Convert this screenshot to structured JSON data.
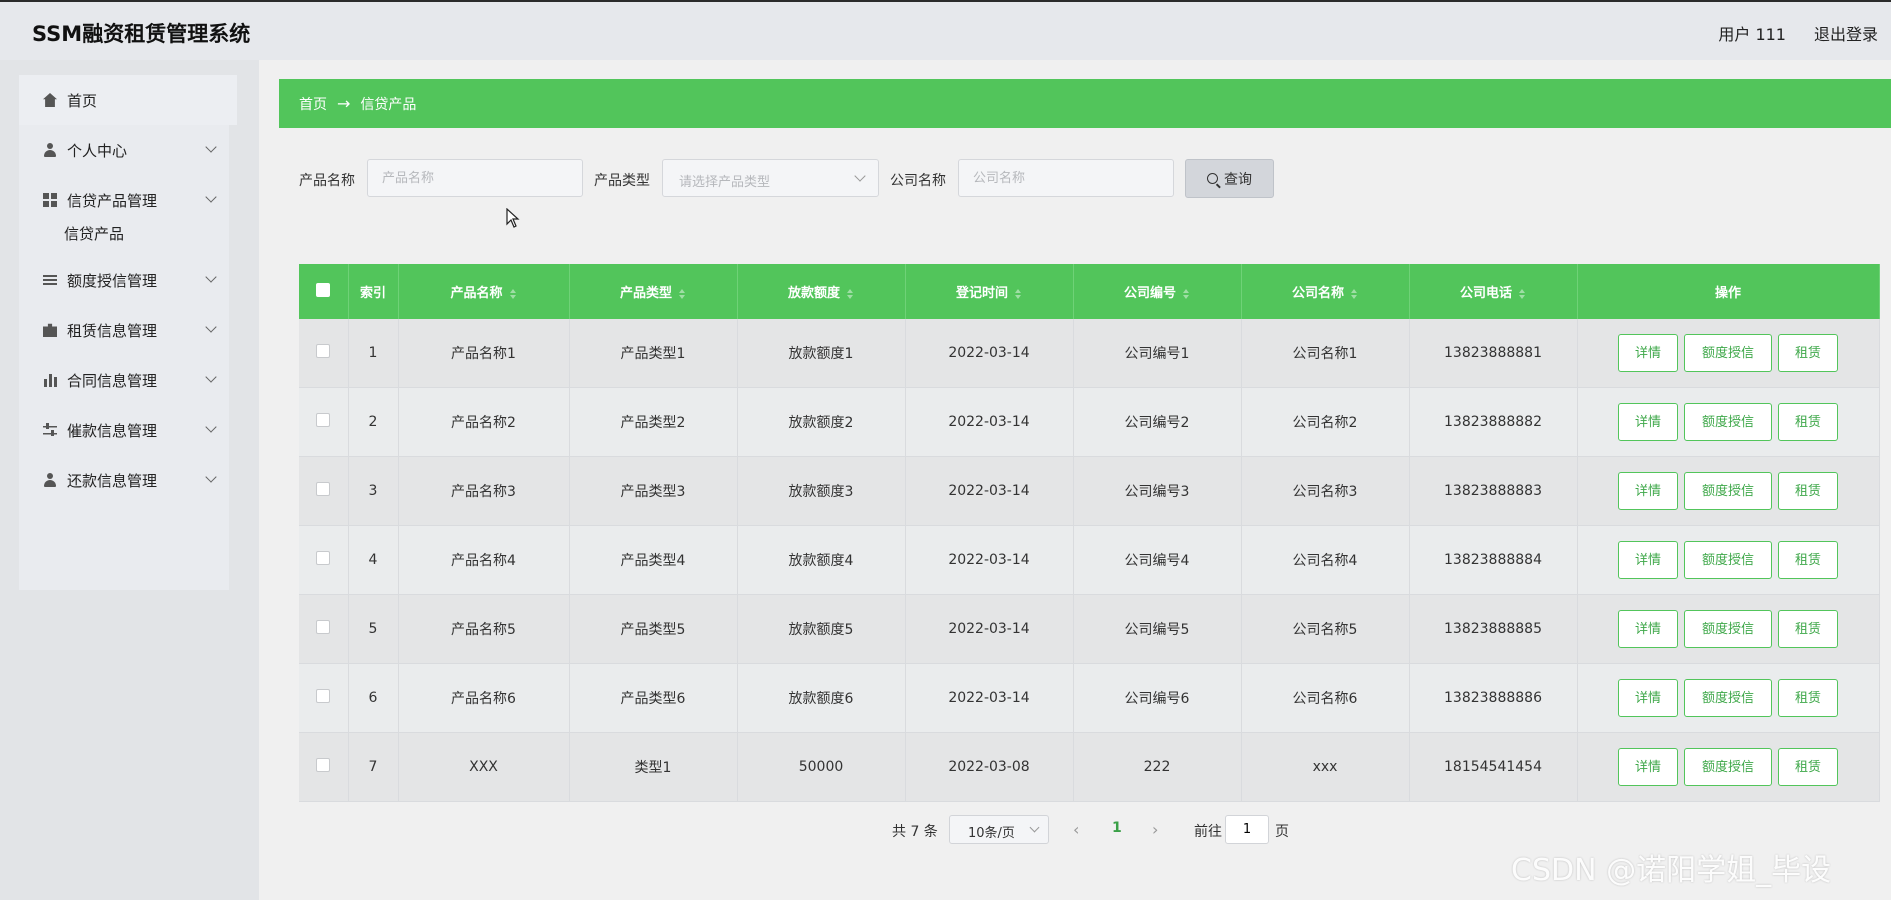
{
  "header": {
    "title": "SSM融资租赁管理系统",
    "user": "用户 111",
    "logout": "退出登录"
  },
  "sidebar": {
    "items": [
      {
        "label": "首页",
        "icon": "home-icon"
      },
      {
        "label": "个人中心",
        "icon": "user-icon"
      },
      {
        "label": "信贷产品管理",
        "icon": "grid-icon"
      },
      {
        "label": "额度授信管理",
        "icon": "list-icon"
      },
      {
        "label": "租赁信息管理",
        "icon": "briefcase-icon"
      },
      {
        "label": "合同信息管理",
        "icon": "bar-chart-icon"
      },
      {
        "label": "催款信息管理",
        "icon": "sliders-icon"
      },
      {
        "label": "还款信息管理",
        "icon": "user-icon"
      }
    ],
    "sub_item": "信贷产品"
  },
  "breadcrumb": {
    "home": "首页",
    "arrow": "→",
    "current": "信贷产品"
  },
  "search": {
    "name_label": "产品名称",
    "name_placeholder": "产品名称",
    "type_label": "产品类型",
    "type_placeholder": "请选择产品类型",
    "company_label": "公司名称",
    "company_placeholder": "公司名称",
    "button": "查询"
  },
  "table": {
    "headers": [
      "索引",
      "产品名称",
      "产品类型",
      "放款额度",
      "登记时间",
      "公司编号",
      "公司名称",
      "公司电话",
      "操作"
    ],
    "rows": [
      [
        "1",
        "产品名称1",
        "产品类型1",
        "放款额度1",
        "2022-03-14",
        "公司编号1",
        "公司名称1",
        "13823888881"
      ],
      [
        "2",
        "产品名称2",
        "产品类型2",
        "放款额度2",
        "2022-03-14",
        "公司编号2",
        "公司名称2",
        "13823888882"
      ],
      [
        "3",
        "产品名称3",
        "产品类型3",
        "放款额度3",
        "2022-03-14",
        "公司编号3",
        "公司名称3",
        "13823888883"
      ],
      [
        "4",
        "产品名称4",
        "产品类型4",
        "放款额度4",
        "2022-03-14",
        "公司编号4",
        "公司名称4",
        "13823888884"
      ],
      [
        "5",
        "产品名称5",
        "产品类型5",
        "放款额度5",
        "2022-03-14",
        "公司编号5",
        "公司名称5",
        "13823888885"
      ],
      [
        "6",
        "产品名称6",
        "产品类型6",
        "放款额度6",
        "2022-03-14",
        "公司编号6",
        "公司名称6",
        "13823888886"
      ],
      [
        "7",
        "XXX",
        "类型1",
        "50000",
        "2022-03-08",
        "222",
        "xxx",
        "18154541454"
      ]
    ],
    "actions": {
      "detail": "详情",
      "credit": "额度授信",
      "lease": "租赁"
    }
  },
  "pagination": {
    "total": "共 7 条",
    "page_size": "10条/页",
    "prev": "‹",
    "current": "1",
    "next": "›",
    "goto": "前往",
    "goto_value": "1",
    "page_suffix": "页"
  },
  "watermark": "CSDN @诺阳学姐_毕设",
  "colors": {
    "accent": "#52c55b",
    "button_text": "#3fa84a"
  }
}
